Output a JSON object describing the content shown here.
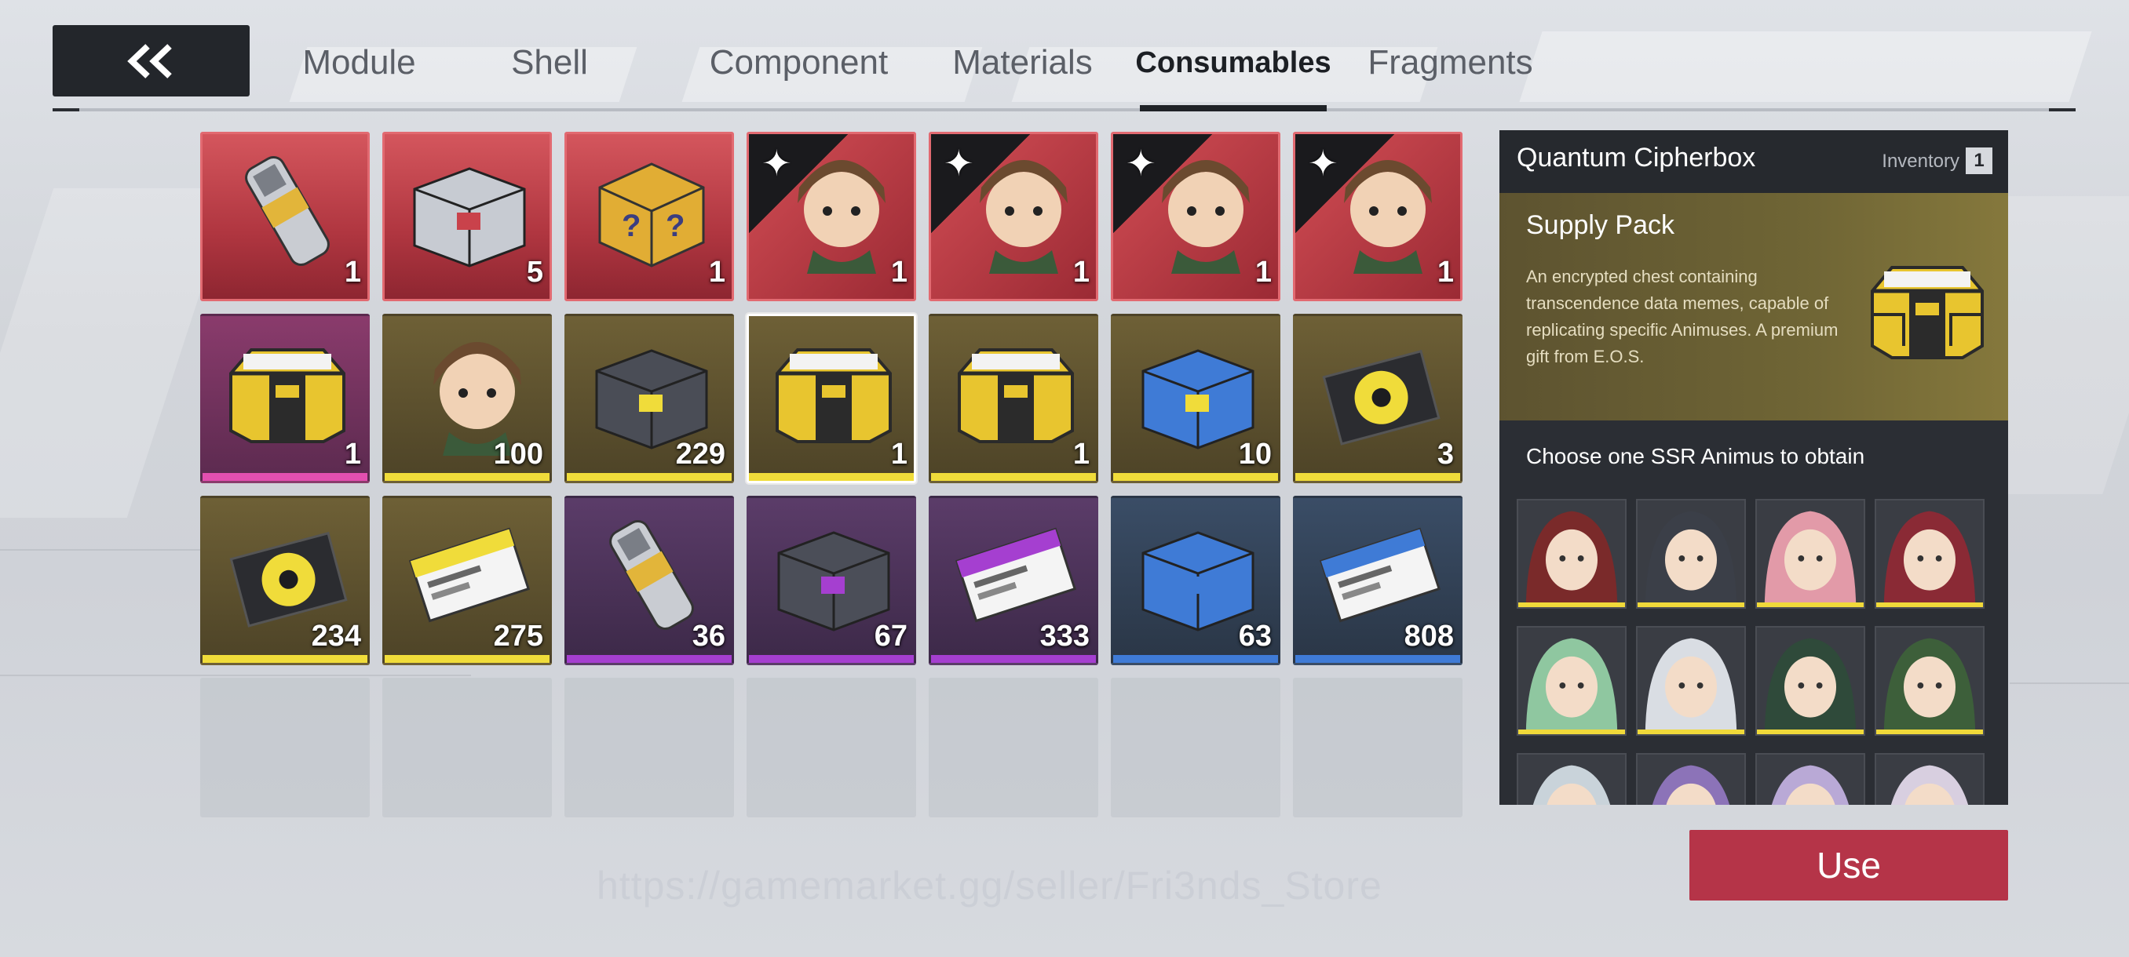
{
  "tabs": [
    {
      "label": "Module",
      "active": false
    },
    {
      "label": "Shell",
      "active": false
    },
    {
      "label": "Component",
      "active": false
    },
    {
      "label": "Materials",
      "active": false
    },
    {
      "label": "Consumables",
      "active": true
    },
    {
      "label": "Fragments",
      "active": false
    }
  ],
  "back_icon": "double-chevron-left-icon",
  "items": [
    {
      "name": "supply-canister",
      "count": "1",
      "rarity": "red",
      "color": "#c9424b"
    },
    {
      "name": "silver-crate",
      "count": "5",
      "rarity": "red",
      "color": "#c9424b"
    },
    {
      "name": "mystery-box",
      "count": "1",
      "rarity": "red",
      "color": "#c9424b"
    },
    {
      "name": "animus-bear",
      "count": "1",
      "rarity": "red-special",
      "color": "#c9424b"
    },
    {
      "name": "animus-sheep",
      "count": "1",
      "rarity": "red-special",
      "color": "#c9424b"
    },
    {
      "name": "animus-witch",
      "count": "1",
      "rarity": "red-special",
      "color": "#c9424b"
    },
    {
      "name": "animus-wolf",
      "count": "1",
      "rarity": "red-special",
      "color": "#c9424b"
    },
    {
      "name": "gold-cipherbox-pink",
      "count": "1",
      "rarity": "pink",
      "color": "#e34fb0"
    },
    {
      "name": "animus-awaking-ticket",
      "count": "100",
      "rarity": "gold",
      "color": "#f0dc3a"
    },
    {
      "name": "cube-pack",
      "count": "229",
      "rarity": "gold",
      "color": "#f0dc3a"
    },
    {
      "name": "quantum-cipherbox",
      "count": "1",
      "rarity": "gold",
      "color": "#f0dc3a"
    },
    {
      "name": "gold-cipherbox",
      "count": "1",
      "rarity": "gold",
      "color": "#f0dc3a"
    },
    {
      "name": "blue-case",
      "count": "10",
      "rarity": "gold",
      "color": "#f0dc3a"
    },
    {
      "name": "holo-disc",
      "count": "3",
      "rarity": "gold",
      "color": "#f0dc3a"
    },
    {
      "name": "purple-disc",
      "count": "234",
      "rarity": "gold",
      "color": "#f0dc3a"
    },
    {
      "name": "records-book",
      "count": "275",
      "rarity": "gold",
      "color": "#f0dc3a"
    },
    {
      "name": "capsule-device",
      "count": "36",
      "rarity": "purple",
      "color": "#a53fd0"
    },
    {
      "name": "purple-box",
      "count": "67",
      "rarity": "purple",
      "color": "#a53fd0"
    },
    {
      "name": "legend-book",
      "count": "333",
      "rarity": "purple",
      "color": "#a53fd0"
    },
    {
      "name": "blue-box",
      "count": "63",
      "rarity": "blue",
      "color": "#3f7bd6"
    },
    {
      "name": "strange-book",
      "count": "808",
      "rarity": "blue",
      "color": "#3f7bd6"
    }
  ],
  "empty_slots": 7,
  "selected_index": 10,
  "detail": {
    "title": "Quantum Cipherbox",
    "inventory_label": "Inventory",
    "inventory_count": "1",
    "type": "Supply Pack",
    "description": "An encrypted chest containing transcendence data memes, capable of replicating specific Animuses. A premium gift from E.O.S.",
    "choose_label": "Choose one SSR Animus to obtain",
    "portraits": [
      {
        "name": "animus-red-hair"
      },
      {
        "name": "animus-dark-cap"
      },
      {
        "name": "animus-pink-hair"
      },
      {
        "name": "animus-red-witch"
      },
      {
        "name": "animus-green-flower"
      },
      {
        "name": "animus-white-hair"
      },
      {
        "name": "animus-dark-green"
      },
      {
        "name": "animus-green-hat"
      },
      {
        "name": "animus-silver-hair"
      },
      {
        "name": "animus-purple-hair"
      },
      {
        "name": "animus-lilac-hair"
      },
      {
        "name": "animus-white-fluffy"
      }
    ]
  },
  "use_button": "Use",
  "watermark": "https://gamemarket.gg/seller/Fri3nds_Store"
}
